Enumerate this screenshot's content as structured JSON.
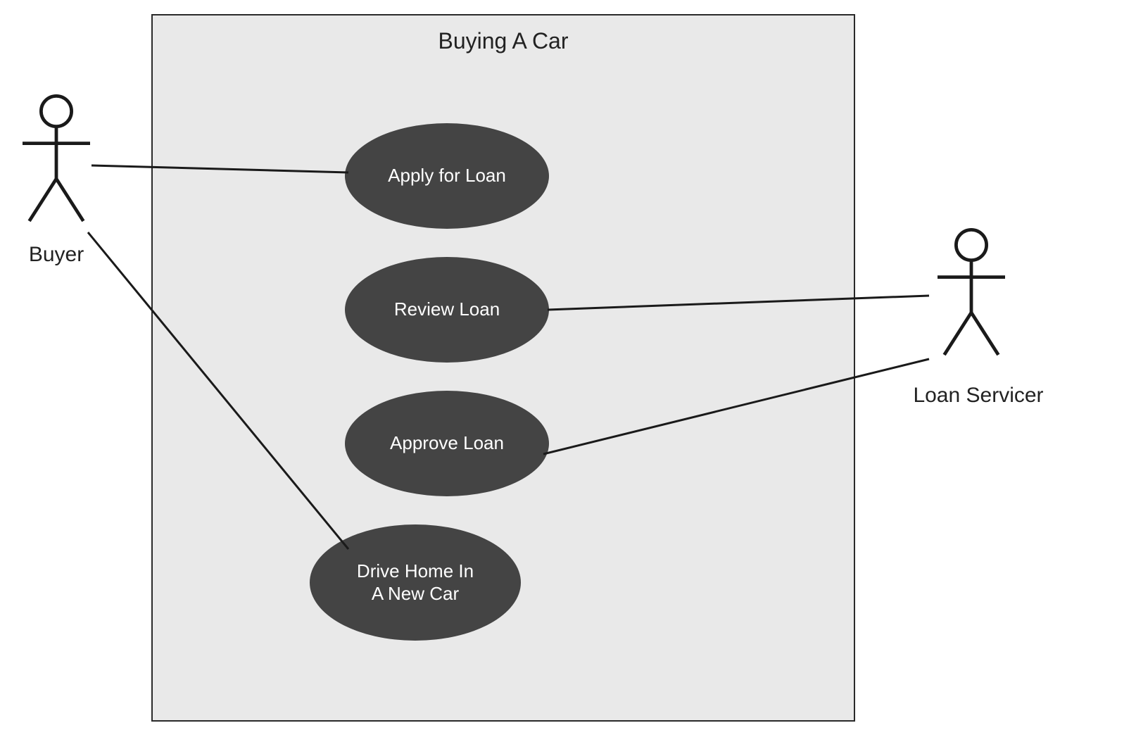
{
  "system": {
    "title": "Buying A Car"
  },
  "actors": {
    "left": {
      "label": "Buyer"
    },
    "right": {
      "label": "Loan Servicer"
    }
  },
  "usecases": {
    "apply": {
      "label": "Apply for Loan"
    },
    "review": {
      "label": "Review Loan"
    },
    "approve": {
      "label": "Approve Loan"
    },
    "drive": {
      "label": "Drive Home In\nA New Car"
    }
  },
  "associations": [
    {
      "from": "Buyer",
      "to": "Apply for Loan"
    },
    {
      "from": "Buyer",
      "to": "Drive Home In A New Car"
    },
    {
      "from": "Loan Servicer",
      "to": "Review Loan"
    },
    {
      "from": "Loan Servicer",
      "to": "Approve Loan"
    }
  ]
}
